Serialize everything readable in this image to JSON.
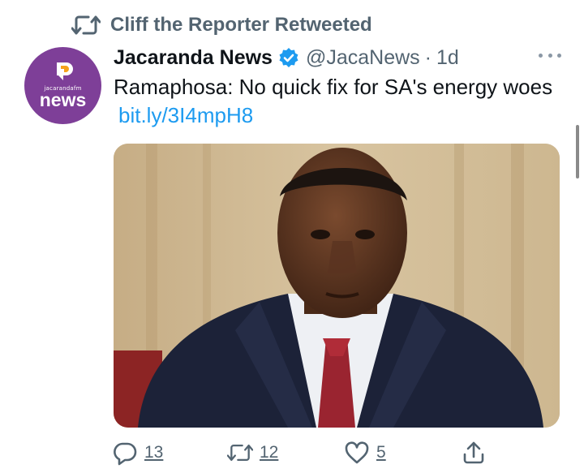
{
  "retweet": {
    "text": "Cliff the Reporter Retweeted"
  },
  "tweet": {
    "avatar": {
      "brand_small": "jacarandafm",
      "brand_big": "news",
      "color": "#7e3f98"
    },
    "display_name": "Jacaranda News",
    "verified": true,
    "handle": "@JacaNews",
    "separator": "·",
    "time": "1d",
    "text": "Ramaphosa: No quick fix for SA's energy woes",
    "link": "bit.ly/3I4mpH8",
    "image_icon": "photo-of-man-in-suit-icon"
  },
  "actions": {
    "reply": {
      "icon": "reply-icon",
      "count": "13"
    },
    "retweet": {
      "icon": "retweet-icon",
      "count": "12"
    },
    "like": {
      "icon": "heart-icon",
      "count": "5"
    },
    "share": {
      "icon": "share-icon"
    }
  },
  "colors": {
    "accent": "#1d9bf0",
    "muted": "#536471",
    "text": "#0f1419"
  }
}
